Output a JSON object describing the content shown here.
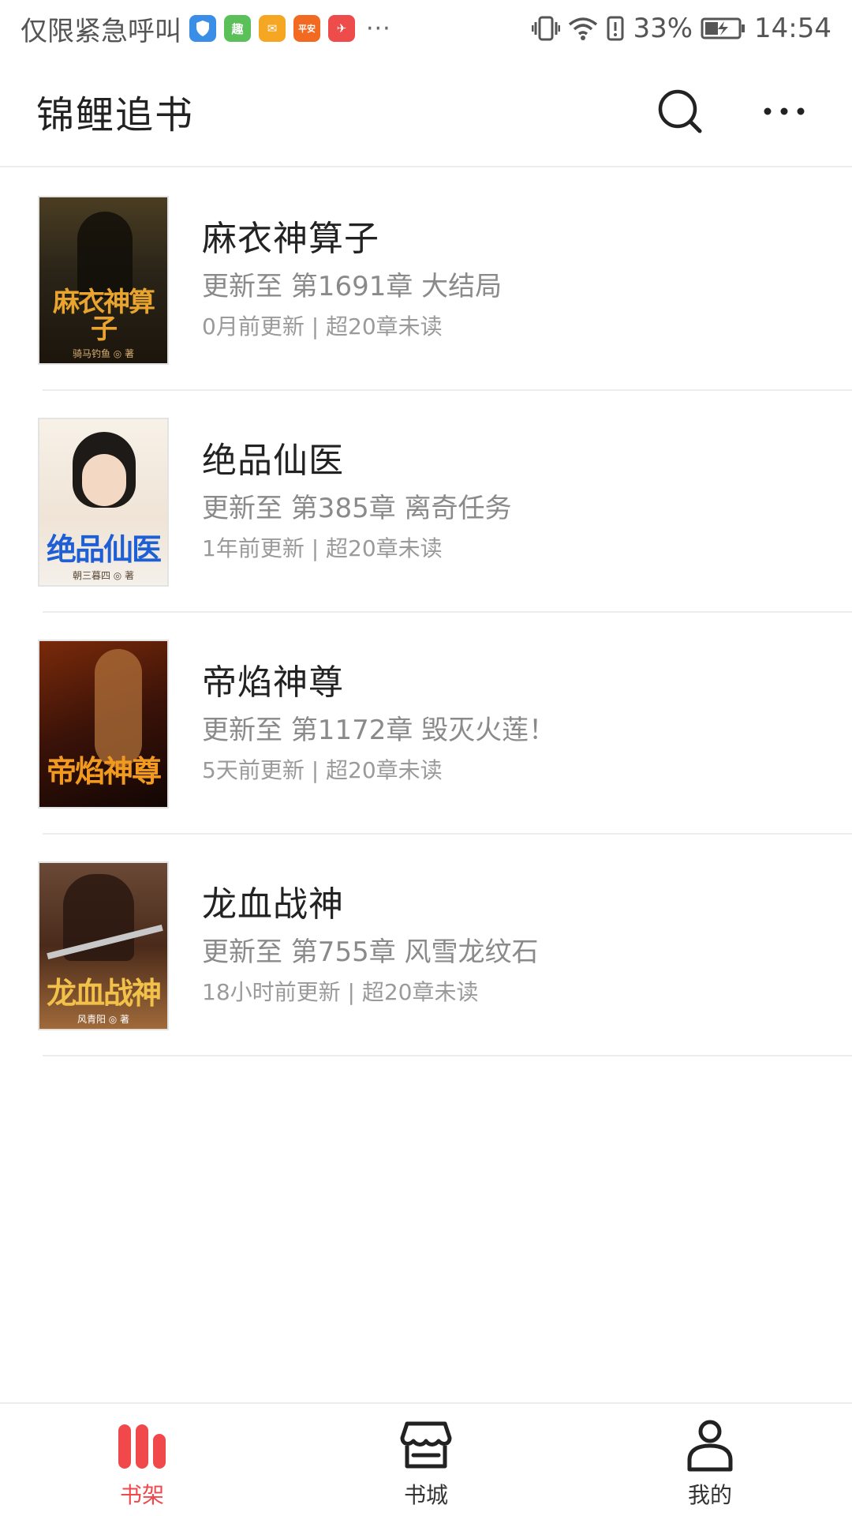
{
  "status_bar": {
    "carrier": "仅限紧急呼叫",
    "more": "···",
    "battery": "33%",
    "time": "14:54",
    "app_icons": [
      {
        "name": "shield-app-icon",
        "color": "#3a8ee6",
        "text": ""
      },
      {
        "name": "qu-app-icon",
        "color": "#5cc05a",
        "text": "趣"
      },
      {
        "name": "mail-app-icon",
        "color": "#f5a623",
        "text": "✉"
      },
      {
        "name": "pingan-bank-app-icon",
        "color": "#f26a21",
        "text": "平安"
      },
      {
        "name": "red-app-icon",
        "color": "#ee4b4b",
        "text": "✈"
      }
    ]
  },
  "header": {
    "title": "锦鲤追书",
    "search_icon": "search-icon",
    "more_icon": "more-icon"
  },
  "books": [
    {
      "title": "麻衣神算子",
      "latest": "更新至 第1691章 大结局",
      "meta": "0月前更新 | 超20章未读",
      "cover_text": "麻衣神算子",
      "cover_author": "骑马钓鱼 ◎ 著",
      "cover_bg": "#2a2418",
      "cover_fg": "#e8a42f"
    },
    {
      "title": "绝品仙医",
      "latest": "更新至 第385章 离奇任务",
      "meta": "1年前更新 | 超20章未读",
      "cover_text": "绝品仙医",
      "cover_author": "朝三暮四 ◎ 著",
      "cover_bg": "#f3ebe1",
      "cover_fg": "#1f5fd6"
    },
    {
      "title": "帝焰神尊",
      "latest": "更新至 第1172章 毁灭火莲！",
      "meta": "5天前更新 | 超20章未读",
      "cover_text": "帝焰神尊",
      "cover_author": "",
      "cover_bg": "#3a1208",
      "cover_fg": "#f29a1e"
    },
    {
      "title": "龙血战神",
      "latest": "更新至 第755章 风雪龙纹石",
      "meta": "18小时前更新 | 超20章未读",
      "cover_text": "龙血战神",
      "cover_author": "风青阳 ◎ 著",
      "cover_bg": "#4a2a1a",
      "cover_fg": "#f2c14a"
    }
  ],
  "bottom_nav": [
    {
      "label": "书架",
      "icon": "bookshelf-icon",
      "active": true
    },
    {
      "label": "书城",
      "icon": "store-icon",
      "active": false
    },
    {
      "label": "我的",
      "icon": "profile-icon",
      "active": false
    }
  ],
  "colors": {
    "accent": "#f0484b",
    "text_primary": "#222222",
    "text_secondary": "#8a8a8a",
    "divider": "#ececec"
  }
}
